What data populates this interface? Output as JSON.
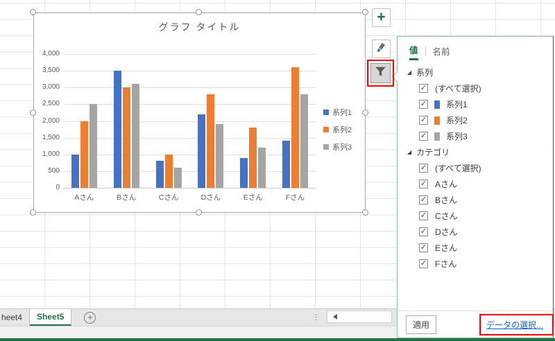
{
  "chart_data": {
    "type": "bar",
    "title": "グラフ タイトル",
    "categories": [
      "Aさん",
      "Bさん",
      "Cさん",
      "Dさん",
      "Eさん",
      "Fさん"
    ],
    "series": [
      {
        "name": "系列1",
        "color": "#4472C4",
        "values": [
          1000,
          3500,
          800,
          2200,
          900,
          1400
        ]
      },
      {
        "name": "系列2",
        "color": "#ED7D31",
        "values": [
          2000,
          3000,
          1000,
          2800,
          1800,
          3600
        ]
      },
      {
        "name": "系列3",
        "color": "#A5A5A5",
        "values": [
          2500,
          3100,
          600,
          1900,
          1200,
          2800
        ]
      }
    ],
    "ylim": [
      0,
      4000
    ],
    "ytick_step": 500,
    "yticks": [
      "4,000",
      "3,500",
      "3,000",
      "2,500",
      "2,000",
      "1,500",
      "1,000",
      "500",
      "0"
    ],
    "grid": true,
    "legend_position": "right"
  },
  "chart_tools": {
    "buttons": [
      {
        "icon": "plus-icon",
        "glyph": "+"
      },
      {
        "icon": "brush-icon"
      },
      {
        "icon": "filter-icon",
        "pressed": true,
        "highlighted": true
      }
    ]
  },
  "filter_panel": {
    "tabs": [
      {
        "label": "値",
        "active": true
      },
      {
        "label": "名前",
        "active": false
      }
    ],
    "sections": [
      {
        "title": "系列",
        "items": [
          {
            "label": "(すべて選択)",
            "checked": true
          },
          {
            "label": "系列1",
            "checked": true,
            "color": "#4472C4"
          },
          {
            "label": "系列2",
            "checked": true,
            "color": "#ED7D31"
          },
          {
            "label": "系列3",
            "checked": true,
            "color": "#A5A5A5"
          }
        ]
      },
      {
        "title": "カテゴリ",
        "items": [
          {
            "label": "(すべて選択)",
            "checked": true
          },
          {
            "label": "Aさん",
            "checked": true
          },
          {
            "label": "Bさん",
            "checked": true
          },
          {
            "label": "Cさん",
            "checked": true
          },
          {
            "label": "Dさん",
            "checked": true
          },
          {
            "label": "Eさん",
            "checked": true
          },
          {
            "label": "Fさん",
            "checked": true
          }
        ]
      }
    ],
    "apply_label": "適用",
    "select_data_label": "データの選択..."
  },
  "sheet_bar": {
    "tabs": [
      {
        "label": "heet4",
        "active": false
      },
      {
        "label": "Sheet5",
        "active": true
      }
    ],
    "add_sheet_icon": "plus-circle-icon"
  },
  "colors": {
    "accent_green": "#217346",
    "link_blue": "#0563C1",
    "highlight_red": "#FF0000",
    "axis_text": "#595959"
  }
}
